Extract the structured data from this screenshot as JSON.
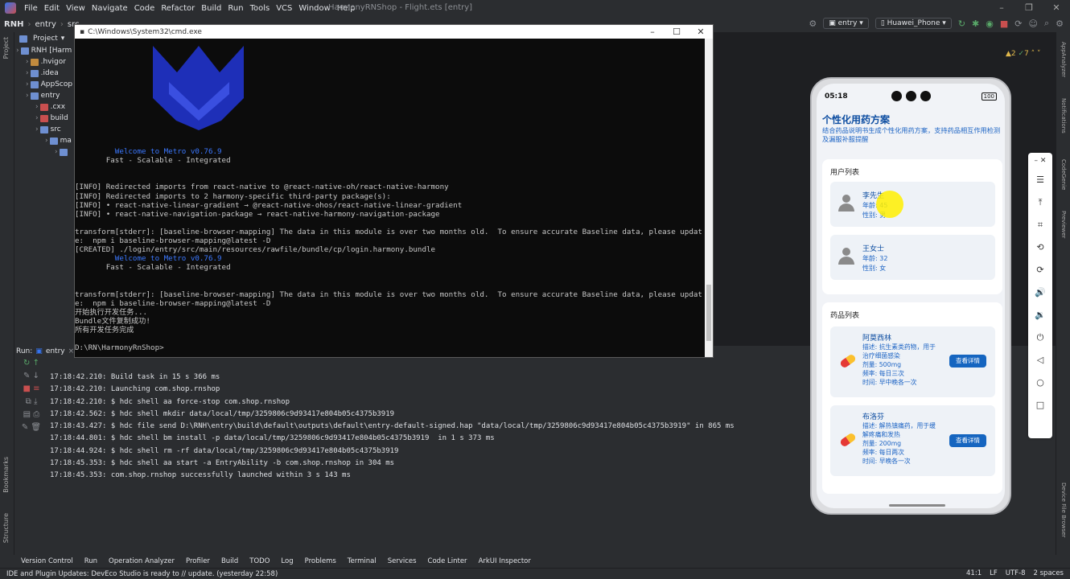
{
  "menubar": {
    "items": [
      "File",
      "Edit",
      "View",
      "Navigate",
      "Code",
      "Refactor",
      "Build",
      "Run",
      "Tools",
      "VCS",
      "Window",
      "Help"
    ],
    "window_title": "HarmonyRNShop - Flight.ets [entry]"
  },
  "toolbar": {
    "crumbs": [
      "RNH",
      "entry",
      "src"
    ],
    "run_config": "entry",
    "device": "Huawei_Phone"
  },
  "project": {
    "header": "Project",
    "tree": [
      {
        "label": "RNH [Harm",
        "indent": 2,
        "color": "#6e8fd1"
      },
      {
        "label": ".hvigor",
        "indent": 14,
        "color": "#c08a3e"
      },
      {
        "label": ".idea",
        "indent": 14,
        "color": "#6e8fd1"
      },
      {
        "label": "AppScop",
        "indent": 14,
        "color": "#6e8fd1"
      },
      {
        "label": "entry",
        "indent": 14,
        "color": "#6e8fd1"
      },
      {
        "label": ".cxx",
        "indent": 26,
        "color": "#c94f4f"
      },
      {
        "label": "build",
        "indent": 26,
        "color": "#c94f4f"
      },
      {
        "label": "src",
        "indent": 26,
        "color": "#6e8fd1"
      },
      {
        "label": "ma",
        "indent": 38,
        "color": "#6e8fd1"
      },
      {
        "label": "",
        "indent": 50,
        "color": "#6e8fd1"
      }
    ]
  },
  "cmd": {
    "title": "C:\\Windows\\System32\\cmd.exe",
    "lines": [
      {
        "t": "         Welcome to Metro v0.76.9",
        "c": "mix"
      },
      {
        "t": "       Fast - Scalable - Integrated",
        "c": ""
      },
      {
        "t": "",
        "c": ""
      },
      {
        "t": "",
        "c": ""
      },
      {
        "t": "[INFO] Redirected imports from react-native to @react-native-oh/react-native-harmony",
        "c": ""
      },
      {
        "t": "[INFO] Redirected imports to 2 harmony-specific third-party package(s):",
        "c": ""
      },
      {
        "t": "[INFO] • react-native-linear-gradient → @react-native-ohos/react-native-linear-gradient",
        "c": ""
      },
      {
        "t": "[INFO] • react-native-navigation-package → react-native-harmony-navigation-package",
        "c": ""
      },
      {
        "t": "",
        "c": ""
      },
      {
        "t": "transform[stderr]: [baseline-browser-mapping] The data in this module is over two months old.  To ensure accurate Baseline data, please updat",
        "c": ""
      },
      {
        "t": "e:  npm i baseline-browser-mapping@latest -D",
        "c": ""
      },
      {
        "t": "[CREATED] ./login/entry/src/main/resources/rawfile/bundle/cp/login.harmony.bundle",
        "c": ""
      },
      {
        "t": "         Welcome to Metro v0.76.9",
        "c": "mix"
      },
      {
        "t": "       Fast - Scalable - Integrated",
        "c": ""
      },
      {
        "t": "",
        "c": ""
      },
      {
        "t": "",
        "c": ""
      },
      {
        "t": "transform[stderr]: [baseline-browser-mapping] The data in this module is over two months old.  To ensure accurate Baseline data, please updat",
        "c": ""
      },
      {
        "t": "e:  npm i baseline-browser-mapping@latest -D",
        "c": ""
      },
      {
        "t": "开始执行开发任务...",
        "c": ""
      },
      {
        "t": "Bundle文件复制成功!",
        "c": ""
      },
      {
        "t": "所有开发任务完成",
        "c": ""
      },
      {
        "t": "",
        "c": ""
      },
      {
        "t": "D:\\RN\\HarmonyRnShop>",
        "c": ""
      }
    ]
  },
  "run": {
    "label": "Run:",
    "tab": "entry",
    "log": [
      "17:18:42.210: Build task in 15 s 366 ms",
      "17:18:42.210: Launching com.shop.rnshop",
      "17:18:42.210: $ hdc shell aa force-stop com.shop.rnshop",
      "17:18:42.562: $ hdc shell mkdir data/local/tmp/3259806c9d93417e804b05c4375b3919",
      "17:18:43.427: $ hdc file send D:\\RNH\\entry\\build\\default\\outputs\\default\\entry-default-signed.hap \"data/local/tmp/3259806c9d93417e804b05c4375b3919\" in 865 ms",
      "17:18:44.801: $ hdc shell bm install -p data/local/tmp/3259806c9d93417e804b05c4375b3919  in 1 s 373 ms",
      "17:18:44.924: $ hdc shell rm -rf data/local/tmp/3259806c9d93417e804b05c4375b3919",
      "17:18:45.353: $ hdc shell aa start -a EntryAbility -b com.shop.rnshop in 304 ms",
      "17:18:45.353: com.shop.rnshop successfully launched within 3 s 143 ms"
    ]
  },
  "bottom_tabs": [
    "Version Control",
    "Run",
    "Operation Analyzer",
    "Profiler",
    "Build",
    "TODO",
    "Log",
    "Problems",
    "Terminal",
    "Services",
    "Code Linter",
    "ArkUI Inspector"
  ],
  "status": {
    "message": "IDE and Plugin Updates: DevEco Studio is ready to // update. (yesterday 22:58)",
    "position": "41:1",
    "line_sep": "LF",
    "encoding": "UTF-8",
    "indent": "2 spaces"
  },
  "editor": {
    "warnings": "2",
    "checks": "7"
  },
  "left_strip": [
    "Project",
    "Bookmarks",
    "Structure"
  ],
  "right_strip": [
    "AppAnalyzer",
    "Notifications",
    "CodeGenie",
    "Previewer",
    "Device File Browser"
  ],
  "phone": {
    "time": "05:18",
    "battery": "100",
    "title": "个性化用药方案",
    "subtitle": "结合药品说明书生成个性化用药方案，支持药品相互作用检测及漏服补服提醒",
    "users_title": "用户列表",
    "users": [
      {
        "name": "李先生",
        "age": "年龄: 45",
        "gender": "性别: 男"
      },
      {
        "name": "王女士",
        "age": "年龄: 32",
        "gender": "性别: 女"
      }
    ],
    "drugs_title": "药品列表",
    "drugs": [
      {
        "name": "阿莫西林",
        "desc": "描述: 抗生素类药物，用于治疗细菌感染",
        "dose": "剂量: 500mg",
        "freq": "频率: 每日三次",
        "time": "时间: 早中晚各一次",
        "btn": "查看详情"
      },
      {
        "name": "布洛芬",
        "desc": "描述: 解热镇痛药，用于缓解疼痛和发热",
        "dose": "剂量: 200mg",
        "freq": "频率: 每日两次",
        "time": "时间: 早晚各一次",
        "btn": "查看详情"
      }
    ]
  }
}
